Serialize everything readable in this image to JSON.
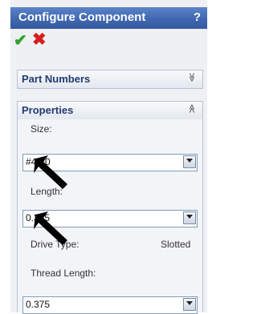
{
  "header": {
    "title": "Configure Component",
    "help": "?"
  },
  "actions": {
    "ok_symbol": "✔",
    "cancel_symbol": "✖"
  },
  "sections": {
    "part_numbers": {
      "label": "Part Numbers",
      "chevron": "≫"
    },
    "properties": {
      "label": "Properties",
      "chevron": "≪"
    }
  },
  "properties": {
    "size_label": "Size:",
    "size_value": "#4-40",
    "length_label": "Length:",
    "length_value": "0.375",
    "drive_type_label": "Drive Type:",
    "drive_type_value": "Slotted",
    "thread_length_label": "Thread Length:",
    "thread_length_value": "0.375"
  }
}
